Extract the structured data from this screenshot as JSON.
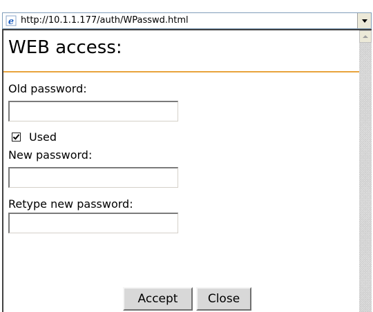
{
  "address_bar": {
    "url": "http://10.1.1.177/auth/WPasswd.html",
    "icon": "ie-page-icon"
  },
  "page": {
    "title": "WEB access:",
    "accent_color": "#e8a33a",
    "old_password_label": "Old password:",
    "old_password_value": "",
    "used_label": "Used",
    "used_checked": true,
    "new_password_label": "New password:",
    "new_password_value": "",
    "retype_password_label": "Retype new password:",
    "retype_password_value": "",
    "accept_label": "Accept",
    "close_label": "Close"
  }
}
